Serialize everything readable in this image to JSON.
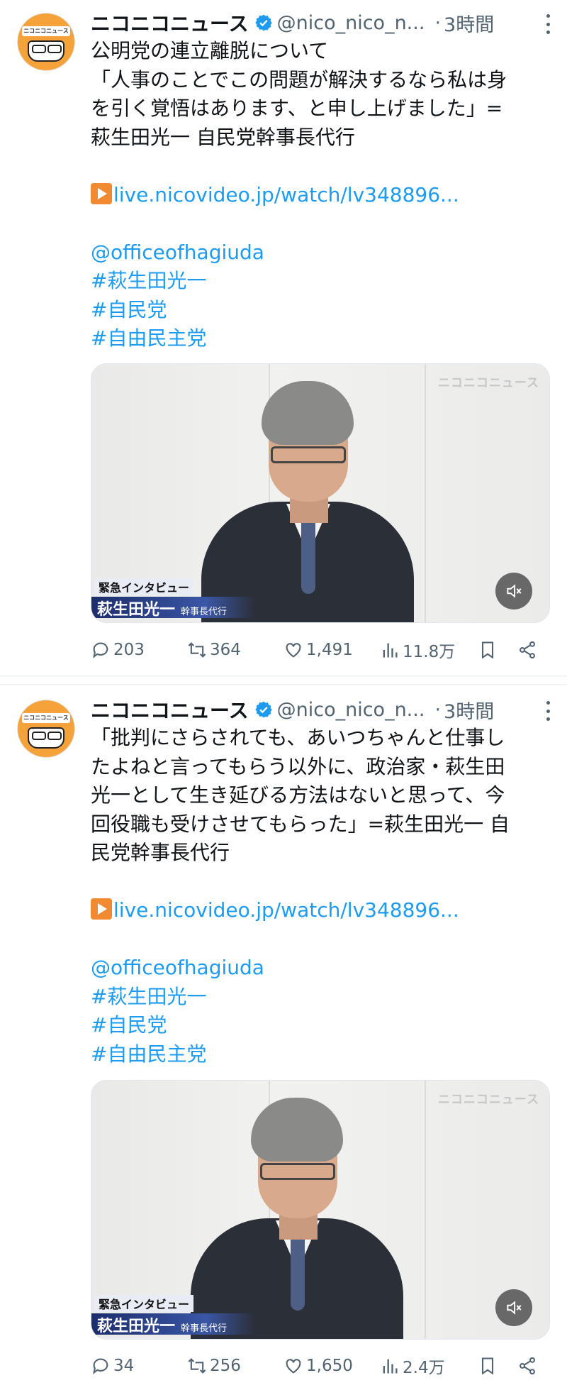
{
  "tweets": [
    {
      "account": {
        "name": "ニコニコニュース",
        "handle": "@nico_nico_n...",
        "separator": "·",
        "time": "3時間",
        "avatar_text": "ニコニコニュース"
      },
      "text_lines": [
        "公明党の連立離脱について",
        "「人事のことでこの問題が解決するなら私は身",
        "を引く覚悟はあります、と申し上げました」=",
        "萩生田光一 自民党幹事長代行"
      ],
      "link": "live.nicovideo.jp/watch/lv348896...",
      "mention": "@officeofhagiuda",
      "hashtags": [
        "#萩生田光一",
        "#自民党",
        "#自由民主党"
      ],
      "media": {
        "watermark": "ニコニコニュース",
        "caption_top": "緊急インタビュー",
        "caption_name": "萩生田光一",
        "caption_role": "幹事長代行"
      },
      "stats": {
        "replies": "203",
        "reposts": "364",
        "likes": "1,491",
        "views": "11.8万"
      }
    },
    {
      "account": {
        "name": "ニコニコニュース",
        "handle": "@nico_nico_n...",
        "separator": "·",
        "time": "3時間",
        "avatar_text": "ニコニコニュース"
      },
      "text_lines": [
        "「批判にさらされても、あいつちゃんと仕事し",
        "たよねと言ってもらう以外に、政治家・萩生田",
        "光一として生き延びる方法はないと思って、今",
        "回役職も受けさせてもらった」=萩生田光一 自",
        "民党幹事長代行"
      ],
      "link": "live.nicovideo.jp/watch/lv348896...",
      "mention": "@officeofhagiuda",
      "hashtags": [
        "#萩生田光一",
        "#自民党",
        "#自由民主党"
      ],
      "media": {
        "watermark": "ニコニコニュース",
        "caption_top": "緊急インタビュー",
        "caption_name": "萩生田光一",
        "caption_role": "幹事長代行"
      },
      "stats": {
        "replies": "34",
        "reposts": "256",
        "likes": "1,650",
        "views": "2.4万"
      }
    }
  ],
  "colors": {
    "link": "#1d9bf0",
    "verified": "#1d9bf0",
    "secondary": "#536471",
    "text": "#0f1419"
  }
}
